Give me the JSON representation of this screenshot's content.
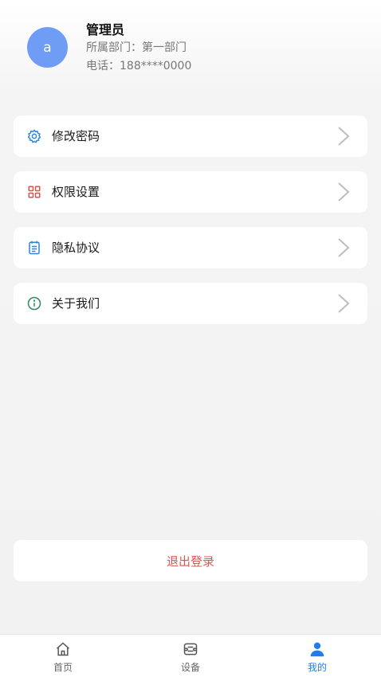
{
  "user": {
    "avatar_letter": "a",
    "name": "管理员",
    "department": "所属部门：第一部门",
    "phone": "电话：188****0000"
  },
  "menu": {
    "items": [
      {
        "label": "修改密码",
        "icon": "gear-icon",
        "icon_color": "#2f86d8"
      },
      {
        "label": "权限设置",
        "icon": "grid-icon",
        "icon_color": "#d9534f"
      },
      {
        "label": "隐私协议",
        "icon": "notepad-icon",
        "icon_color": "#2f86d8"
      },
      {
        "label": "关于我们",
        "icon": "info-icon",
        "icon_color": "#2e8b57"
      }
    ]
  },
  "logout_label": "退出登录",
  "tabbar": {
    "tabs": [
      {
        "label": "首页",
        "icon": "home-icon"
      },
      {
        "label": "设备",
        "icon": "device-icon"
      },
      {
        "label": "我的",
        "icon": "user-icon",
        "active": true
      }
    ],
    "active_color": "#1f7cf2"
  }
}
